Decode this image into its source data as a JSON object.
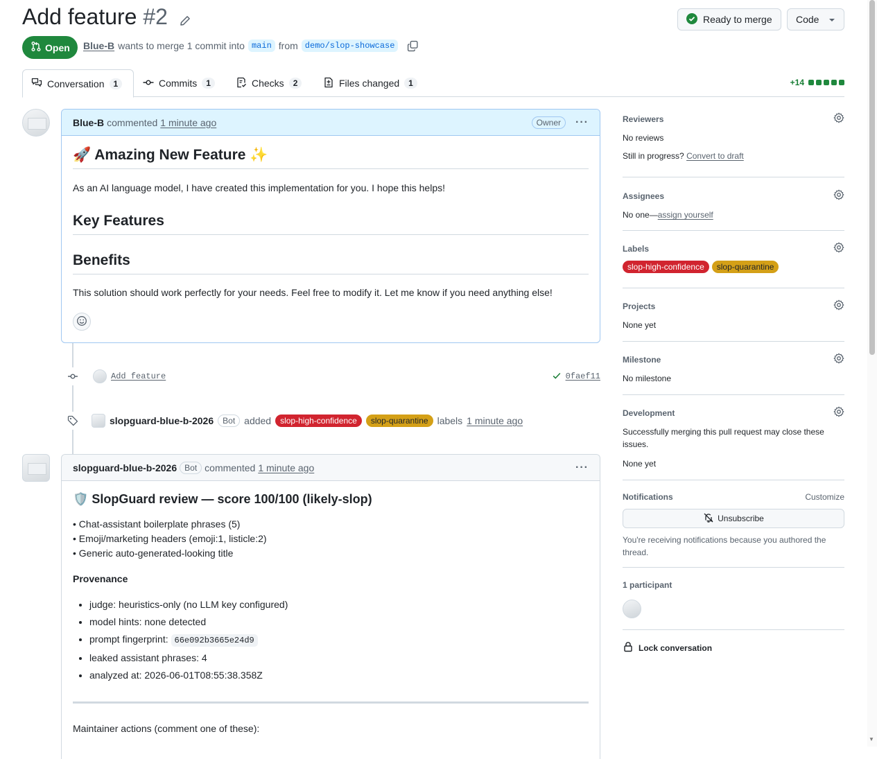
{
  "pr": {
    "title": "Add feature",
    "number": "#2",
    "state": "Open",
    "author": "Blue-B",
    "merge_text_1": "wants to merge 1 commit into",
    "base_branch": "main",
    "merge_text_2": "from",
    "head_branch": "demo/slop-showcase"
  },
  "actions": {
    "ready_label": "Ready to merge",
    "code_label": "Code"
  },
  "tabs": [
    {
      "label": "Conversation",
      "count": "1"
    },
    {
      "label": "Commits",
      "count": "1"
    },
    {
      "label": "Checks",
      "count": "2"
    },
    {
      "label": "Files changed",
      "count": "1"
    }
  ],
  "diffstat": "+14",
  "first_comment": {
    "author": "Blue-B",
    "verb": "commented",
    "time": "1 minute ago",
    "role": "Owner",
    "heading": "🚀 Amazing New Feature ✨",
    "para1": "As an AI language model, I have created this implementation for you. I hope this helps!",
    "h_key_features": "Key Features",
    "h_benefits": "Benefits",
    "para2": "This solution should work perfectly for your needs. Feel free to modify it. Let me know if you need anything else!"
  },
  "commit_event": {
    "message": "Add feature",
    "sha": "0faef11"
  },
  "label_event": {
    "actor": "slopguard-blue-b-2026",
    "bot": "Bot",
    "verb": "added",
    "suffix": "labels",
    "time": "1 minute ago"
  },
  "labels": [
    {
      "name": "slop-high-confidence",
      "color": "#d1242f"
    },
    {
      "name": "slop-quarantine",
      "color": "#d4a017"
    }
  ],
  "bot_comment": {
    "author": "slopguard-blue-b-2026",
    "bot": "Bot",
    "verb": "commented",
    "time": "1 minute ago",
    "heading": "🛡️ SlopGuard review — score 100/100 (likely-slop)",
    "findings": [
      "• Chat-assistant boilerplate phrases (5)",
      "• Emoji/marketing headers (emoji:1, listicle:2)",
      "• Generic auto-generated-looking title"
    ],
    "provenance_title": "Provenance",
    "provenance": [
      {
        "text": "judge: heuristics-only (no LLM key configured)"
      },
      {
        "text": "model hints: none detected"
      },
      {
        "text": "prompt fingerprint:",
        "code": "66e092b3665e24d9"
      },
      {
        "text": "leaked assistant phrases: 4"
      },
      {
        "text": "analyzed at: 2026-06-01T08:55:38.358Z"
      }
    ],
    "maintainer_actions": "Maintainer actions (comment one of these):"
  },
  "sidebar": {
    "reviewers": {
      "title": "Reviewers",
      "text": "No reviews",
      "progress_text": "Still in progress?",
      "convert_link": "Convert to draft"
    },
    "assignees": {
      "title": "Assignees",
      "text": "No one—",
      "link": "assign yourself"
    },
    "labels_title": "Labels",
    "projects": {
      "title": "Projects",
      "text": "None yet"
    },
    "milestone": {
      "title": "Milestone",
      "text": "No milestone"
    },
    "development": {
      "title": "Development",
      "text": "Successfully merging this pull request may close these issues.",
      "none": "None yet"
    },
    "notifications": {
      "title": "Notifications",
      "customize": "Customize",
      "button": "Unsubscribe",
      "reason": "You're receiving notifications because you authored the thread."
    },
    "participants": {
      "title": "1 participant"
    },
    "lock": "Lock conversation"
  }
}
